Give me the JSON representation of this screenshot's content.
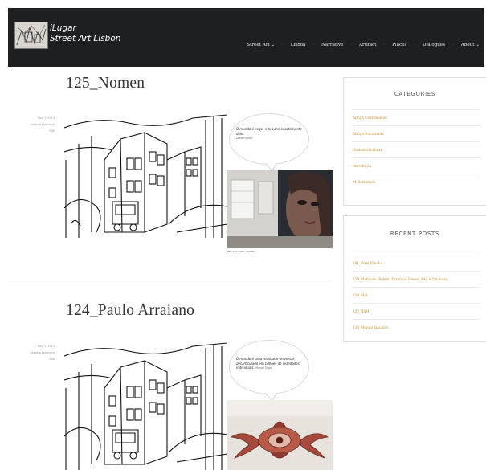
{
  "site": {
    "title_line1": "iLugar",
    "title_line2": "Street Art Lisbon",
    "nav": [
      {
        "label": "Street Art",
        "dropdown": true
      },
      {
        "label": "Lisboa",
        "dropdown": false
      },
      {
        "label": "Narrative",
        "dropdown": false
      },
      {
        "label": "Artifact",
        "dropdown": false
      },
      {
        "label": "Places",
        "dropdown": false
      },
      {
        "label": "Dialogues",
        "dropdown": false
      },
      {
        "label": "About",
        "dropdown": true
      }
    ]
  },
  "posts": [
    {
      "title": "125_Nomen",
      "meta_date": "May 1, 2014",
      "meta_comments": "Leave a comment",
      "meta_author": "Edit",
      "quote": "O mundo é cego, e tu vens exactamente dele.",
      "quote_author": "Dona Pignier",
      "photo_caption": "Ref: 125 Autor: Nomen"
    },
    {
      "title": "124_Paulo Arraiano",
      "meta_date": "May 1, 2014",
      "meta_comments": "Leave a comment",
      "meta_author": "Edit",
      "quote": "O mundo é uma realidade universal, desarticulado em bilhões de realidades individuais.",
      "quote_author": "Miguel Torga"
    }
  ],
  "sidebar": {
    "categories_title": "CATEGORIES",
    "categories": [
      "Antiga Centralidade",
      "Antiga Ruralidade",
      "Desindustrializar",
      "Introdução",
      "Modernidade"
    ],
    "recent_title": "RECENT POSTS",
    "recent": [
      "141_Pixel Pancho",
      "139_Mabuoso, Belém, Zaratiua, Neves, SAS e Tinaboss",
      "138_Mar",
      "137_RAM",
      "136_Miguel Januário"
    ]
  },
  "colors": {
    "header_bg": "#1e1f21",
    "link": "#c8902c"
  }
}
